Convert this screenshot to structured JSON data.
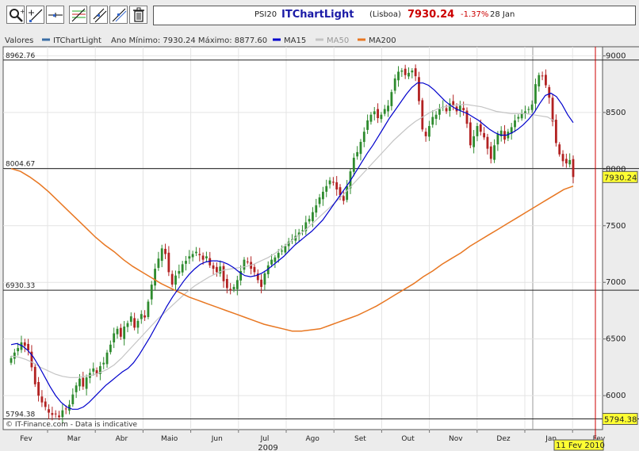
{
  "toolbar": {
    "buttons": [
      {
        "name": "zoom-tool-button",
        "icon": "magnifier-icon"
      },
      {
        "name": "trendline-tool-button",
        "icon": "trendline-icon"
      },
      {
        "name": "horizontal-line-tool-button",
        "icon": "horizontal-line-icon"
      },
      {
        "name": "fibonacci-tool-button",
        "icon": "fibonacci-icon"
      },
      {
        "name": "channel-tool-button",
        "icon": "channel-icon"
      },
      {
        "name": "parallel-line-tool-button",
        "icon": "parallel-line-icon"
      },
      {
        "name": "delete-tool-button",
        "icon": "trash-icon"
      }
    ]
  },
  "info": {
    "symbol": "PSI20",
    "app_name": "ITChartLight",
    "market": "(Lisboa)",
    "price": "7930.24",
    "change": "-1.37%",
    "date": "28 Jan",
    "price_color": "#cc0000"
  },
  "legend": {
    "values_label": "Valores",
    "series_label": "ITChartLight",
    "range_text": "Ano Mínimo: 7930.24 Máximo: 8877.60",
    "ma15_label": "MA15",
    "ma50_label": "MA50",
    "ma200_label": "MA200"
  },
  "footer": {
    "copyright": "© IT-Finance.com - Data is indicative",
    "year": "2009",
    "cursor_date": "11 Fev 2010"
  },
  "chart_data": {
    "type": "line",
    "title": "PSI20",
    "y_scale": "linear",
    "ylim": [
      5700,
      9080
    ],
    "y_ticks": [
      6000,
      6500,
      7000,
      7500,
      8000,
      8500,
      9000
    ],
    "x_tick_labels": [
      "Fev",
      "Mar",
      "Abr",
      "Maio",
      "Jun",
      "Jul",
      "Ago",
      "Set",
      "Out",
      "Nov",
      "Dez",
      "Jan",
      "Fev"
    ],
    "reference_lines": [
      {
        "label": "8962.76",
        "value": 8962.76
      },
      {
        "label": "8004.67",
        "value": 8004.67
      },
      {
        "label": "6930.33",
        "value": 6930.33
      },
      {
        "label": "5794.38",
        "value": 5794.38
      }
    ],
    "last_price_label": "7930.24",
    "last_price": 7930.24,
    "colors": {
      "up": "#2e8b2e",
      "down": "#b22222",
      "ma15": "#0000cc",
      "ma50": "#c4c4c4",
      "ma200": "#e87722",
      "series_legend": "#3a6ea5",
      "ref_line": "#222222",
      "cursor_line": "#cc0000",
      "last_price_bg": "#ffff33"
    },
    "candles_close": [
      6330,
      6380,
      6420,
      6470,
      6440,
      6400,
      6250,
      6100,
      6000,
      5940,
      5900,
      5850,
      5830,
      5840,
      5810,
      5870,
      5880,
      5920,
      6010,
      6090,
      6150,
      6080,
      6160,
      6200,
      6240,
      6190,
      6260,
      6290,
      6380,
      6450,
      6550,
      6590,
      6520,
      6610,
      6640,
      6700,
      6600,
      6660,
      6720,
      6690,
      6830,
      6980,
      7120,
      7210,
      7300,
      7250,
      7090,
      6980,
      7060,
      7100,
      7160,
      7190,
      7230,
      7250,
      7270,
      7240,
      7200,
      7230,
      7150,
      7120,
      7090,
      7140,
      7010,
      6950,
      6930,
      6960,
      7020,
      7100,
      7200,
      7180,
      7120,
      7090,
      7020,
      6960,
      7080,
      7150,
      7200,
      7220,
      7260,
      7280,
      7320,
      7360,
      7380,
      7410,
      7440,
      7460,
      7530,
      7560,
      7620,
      7680,
      7750,
      7800,
      7850,
      7900,
      7880,
      7820,
      7770,
      7720,
      7850,
      7980,
      8100,
      8150,
      8240,
      8330,
      8430,
      8480,
      8510,
      8450,
      8480,
      8530,
      8560,
      8680,
      8800,
      8860,
      8870,
      8830,
      8850,
      8870,
      8820,
      8600,
      8350,
      8290,
      8380,
      8460,
      8480,
      8530,
      8550,
      8510,
      8580,
      8560,
      8510,
      8560,
      8520,
      8400,
      8210,
      8290,
      8380,
      8330,
      8280,
      8180,
      8090,
      8210,
      8310,
      8340,
      8260,
      8330,
      8370,
      8430,
      8460,
      8490,
      8510,
      8530,
      8570,
      8750,
      8830,
      8820,
      8740,
      8630,
      8420,
      8230,
      8130,
      8070,
      8050,
      8080,
      7930.24
    ],
    "ma15": [
      6450,
      6460,
      6440,
      6400,
      6340,
      6260,
      6170,
      6080,
      6000,
      5940,
      5900,
      5880,
      5880,
      5900,
      5940,
      5990,
      6040,
      6090,
      6130,
      6170,
      6210,
      6240,
      6290,
      6360,
      6440,
      6520,
      6610,
      6700,
      6790,
      6870,
      6940,
      7010,
      7070,
      7120,
      7160,
      7180,
      7190,
      7190,
      7180,
      7160,
      7130,
      7090,
      7060,
      7050,
      7060,
      7080,
      7110,
      7150,
      7190,
      7230,
      7280,
      7330,
      7370,
      7410,
      7450,
      7500,
      7550,
      7620,
      7690,
      7760,
      7830,
      7900,
      7980,
      8060,
      8140,
      8210,
      8290,
      8370,
      8450,
      8520,
      8590,
      8660,
      8720,
      8760,
      8760,
      8740,
      8700,
      8650,
      8600,
      8560,
      8530,
      8510,
      8490,
      8460,
      8430,
      8390,
      8350,
      8320,
      8300,
      8300,
      8320,
      8350,
      8390,
      8440,
      8500,
      8580,
      8650,
      8670,
      8640,
      8570,
      8480,
      8410
    ],
    "ma50": [
      6350,
      6340,
      6320,
      6290,
      6250,
      6220,
      6190,
      6170,
      6160,
      6160,
      6170,
      6180,
      6200,
      6230,
      6270,
      6330,
      6400,
      6470,
      6540,
      6610,
      6680,
      6740,
      6800,
      6860,
      6920,
      6970,
      7010,
      7050,
      7080,
      7110,
      7120,
      7130,
      7140,
      7160,
      7190,
      7220,
      7260,
      7310,
      7360,
      7410,
      7460,
      7520,
      7580,
      7640,
      7700,
      7760,
      7830,
      7900,
      7970,
      8040,
      8110,
      8180,
      8250,
      8310,
      8370,
      8420,
      8460,
      8500,
      8530,
      8550,
      8560,
      8570,
      8570,
      8560,
      8550,
      8530,
      8510,
      8500,
      8490,
      8490,
      8490,
      8480,
      8470,
      8460,
      8420
    ],
    "ma200": [
      8004.67,
      7980,
      7930,
      7870,
      7800,
      7720,
      7640,
      7560,
      7480,
      7400,
      7330,
      7270,
      7200,
      7140,
      7090,
      7040,
      6990,
      6950,
      6910,
      6870,
      6840,
      6810,
      6780,
      6750,
      6720,
      6690,
      6660,
      6630,
      6610,
      6590,
      6570,
      6570,
      6580,
      6590,
      6620,
      6650,
      6680,
      6710,
      6750,
      6790,
      6840,
      6890,
      6940,
      6990,
      7050,
      7100,
      7160,
      7210,
      7260,
      7320,
      7370,
      7420,
      7470,
      7520,
      7570,
      7620,
      7670,
      7720,
      7770,
      7820,
      7850
    ]
  }
}
